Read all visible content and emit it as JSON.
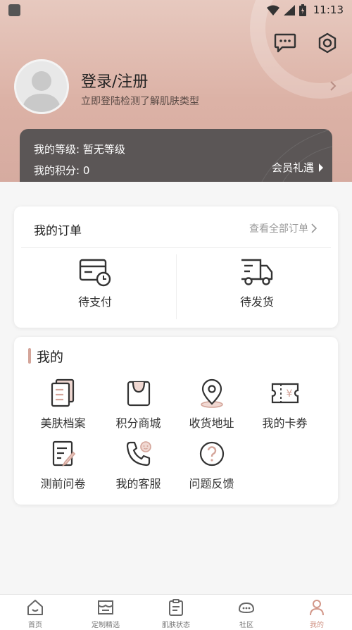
{
  "status_bar": {
    "time": "11:13"
  },
  "profile": {
    "title": "登录/注册",
    "subtitle": "立即登陆检测了解肌肤类型"
  },
  "member": {
    "level": "我的等级: 暂无等级",
    "points": "我的积分: 0",
    "benefit": "会员礼遇"
  },
  "orders": {
    "title": "我的订单",
    "view_all": "查看全部订单",
    "items": [
      {
        "label": "待支付",
        "icon": "wallet-clock-icon"
      },
      {
        "label": "待发货",
        "icon": "truck-icon"
      }
    ]
  },
  "mine": {
    "title": "我的",
    "items": [
      {
        "label": "美肤档案",
        "icon": "document-stack-icon"
      },
      {
        "label": "积分商城",
        "icon": "shopping-bag-icon"
      },
      {
        "label": "收货地址",
        "icon": "location-pin-icon"
      },
      {
        "label": "我的卡券",
        "icon": "coupon-yen-icon"
      },
      {
        "label": "测前问卷",
        "icon": "questionnaire-icon"
      },
      {
        "label": "我的客服",
        "icon": "customer-service-icon"
      },
      {
        "label": "问题反馈",
        "icon": "question-circle-icon"
      }
    ]
  },
  "tabbar": {
    "items": [
      {
        "label": "首页",
        "icon": "home-icon"
      },
      {
        "label": "定制精选",
        "icon": "store-icon"
      },
      {
        "label": "肌肤状态",
        "icon": "clipboard-icon"
      },
      {
        "label": "社区",
        "icon": "community-icon"
      },
      {
        "label": "我的",
        "icon": "person-icon"
      }
    ],
    "active_index": 4
  },
  "colors": {
    "accent": "#d4a59a",
    "header_bg": "#dcb2a6",
    "member_card": "#5b5656",
    "active_tab": "#d29789"
  }
}
